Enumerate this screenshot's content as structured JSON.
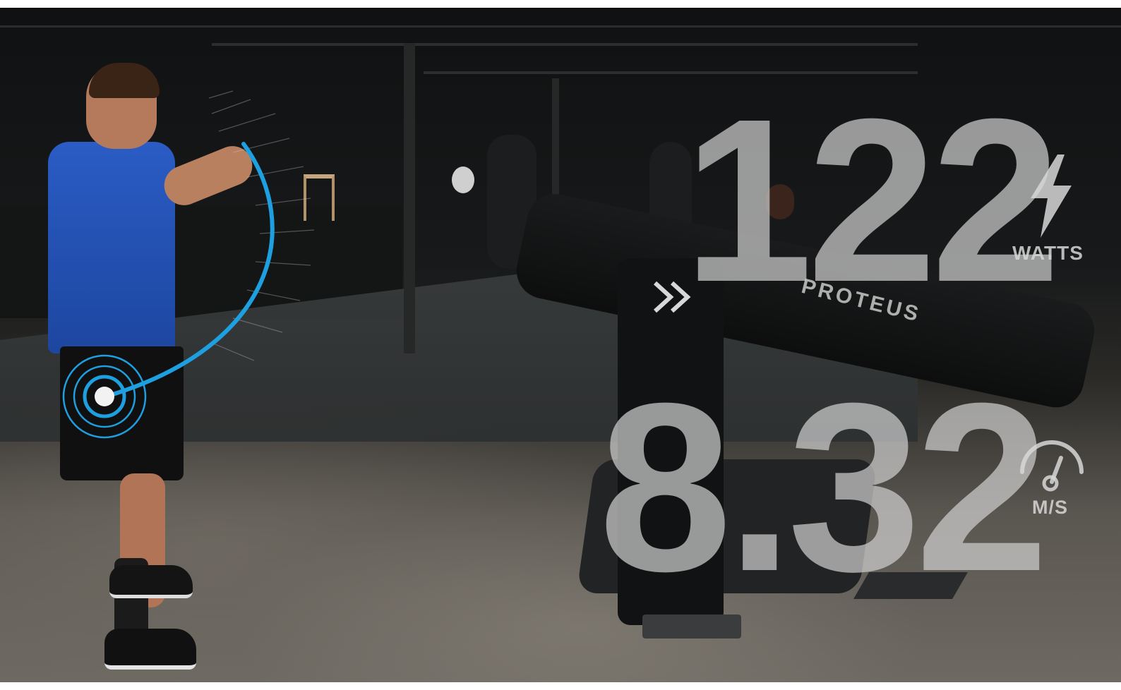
{
  "scene": {
    "brand_text": "PROTEUS",
    "chevron_icon": "double-chevron-icon"
  },
  "metrics": {
    "power": {
      "value": "122",
      "unit": "WATTS",
      "icon": "lightning-bolt-icon"
    },
    "speed": {
      "value": "8.32",
      "unit": "M/S",
      "icon": "speedometer-icon"
    }
  },
  "colors": {
    "accent": "#1e9fe0",
    "metric_text": "#cdcdcd",
    "shirt": "#2a5cc4"
  }
}
